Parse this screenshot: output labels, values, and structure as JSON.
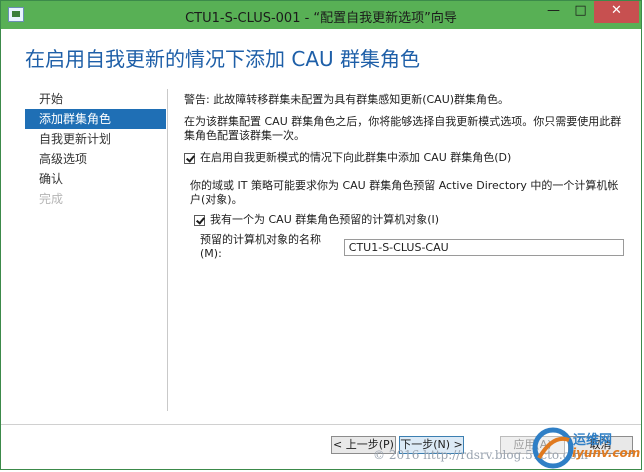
{
  "window": {
    "title": "CTU1-S-CLUS-001 - “配置自我更新选项”向导",
    "minimize": "—",
    "maximize": "□",
    "close": "✕"
  },
  "page_title": "在启用自我更新的情况下添加 CAU 群集角色",
  "nav": {
    "items": [
      {
        "label": "开始"
      },
      {
        "label": "添加群集角色"
      },
      {
        "label": "自我更新计划"
      },
      {
        "label": "高级选项"
      },
      {
        "label": "确认"
      },
      {
        "label": "完成"
      }
    ]
  },
  "content": {
    "warning": "警告: 此故障转移群集未配置为具有群集感知更新(CAU)群集角色。",
    "info": "在为该群集配置 CAU 群集角色之后，你将能够选择自我更新模式选项。你只需要使用此群集角色配置该群集一次。",
    "enable_checkbox_label": "在启用自我更新模式的情况下向此群集中添加 CAU 群集角色(D)",
    "domain_policy": "你的域或 IT 策略可能要求你为 CAU 群集角色预留 Active Directory 中的一个计算机帐户(对象)。",
    "prestaged_checkbox_label": "我有一个为 CAU 群集角色预留的计算机对象(I)",
    "name_label": "预留的计算机对象的名称(M):",
    "name_value": "CTU1-S-CLUS-CAU"
  },
  "buttons": {
    "prev": "< 上一步(P)",
    "next": "下一步(N) >",
    "apply": "应用(A)",
    "cancel": "取消"
  },
  "watermark": "© 2016 http://rdsrv.blog.51cto.com",
  "logo": {
    "text": "运维网",
    "sub": "iyunv.com"
  },
  "colors": {
    "titlebar": "#58b055",
    "accent": "#1e5fa8",
    "nav_selected": "#1f6fb5"
  }
}
